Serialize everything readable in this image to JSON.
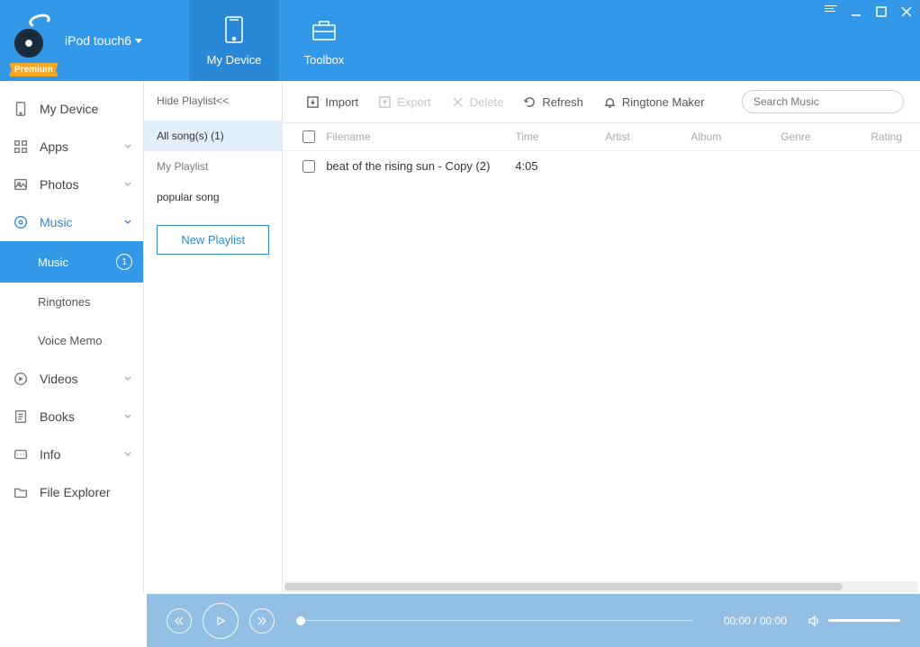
{
  "brand": {
    "device_name": "iPod touch6",
    "premium_label": "Premium"
  },
  "header_tabs": {
    "my_device": "My Device",
    "toolbox": "Toolbox"
  },
  "sidebar": {
    "my_device": "My Device",
    "apps": "Apps",
    "photos": "Photos",
    "music": "Music",
    "music_sub": {
      "music": "Music",
      "music_count": "1",
      "ringtones": "Ringtones",
      "voice_memo": "Voice Memo"
    },
    "videos": "Videos",
    "books": "Books",
    "info": "Info",
    "file_explorer": "File Explorer"
  },
  "playlist_panel": {
    "hide": "Hide Playlist<<",
    "items": [
      {
        "label": "All song(s)  (1)",
        "selected": true
      },
      {
        "label": "My Playlist",
        "selected": false
      },
      {
        "label": "popular song",
        "selected": false
      }
    ],
    "new_playlist": "New Playlist"
  },
  "toolbar": {
    "import": "Import",
    "export": "Export",
    "delete": "Delete",
    "refresh": "Refresh",
    "ringtone_maker": "Ringtone Maker",
    "search_placeholder": "Search Music"
  },
  "table": {
    "columns": {
      "filename": "Filename",
      "time": "Time",
      "artist": "Artist",
      "album": "Album",
      "genre": "Genre",
      "rating": "Rating"
    },
    "rows": [
      {
        "filename": "beat of the rising sun - Copy (2)",
        "time": "4:05",
        "artist": "",
        "album": "",
        "genre": "",
        "rating": ""
      }
    ]
  },
  "player": {
    "time": "00:00 / 00:00"
  }
}
